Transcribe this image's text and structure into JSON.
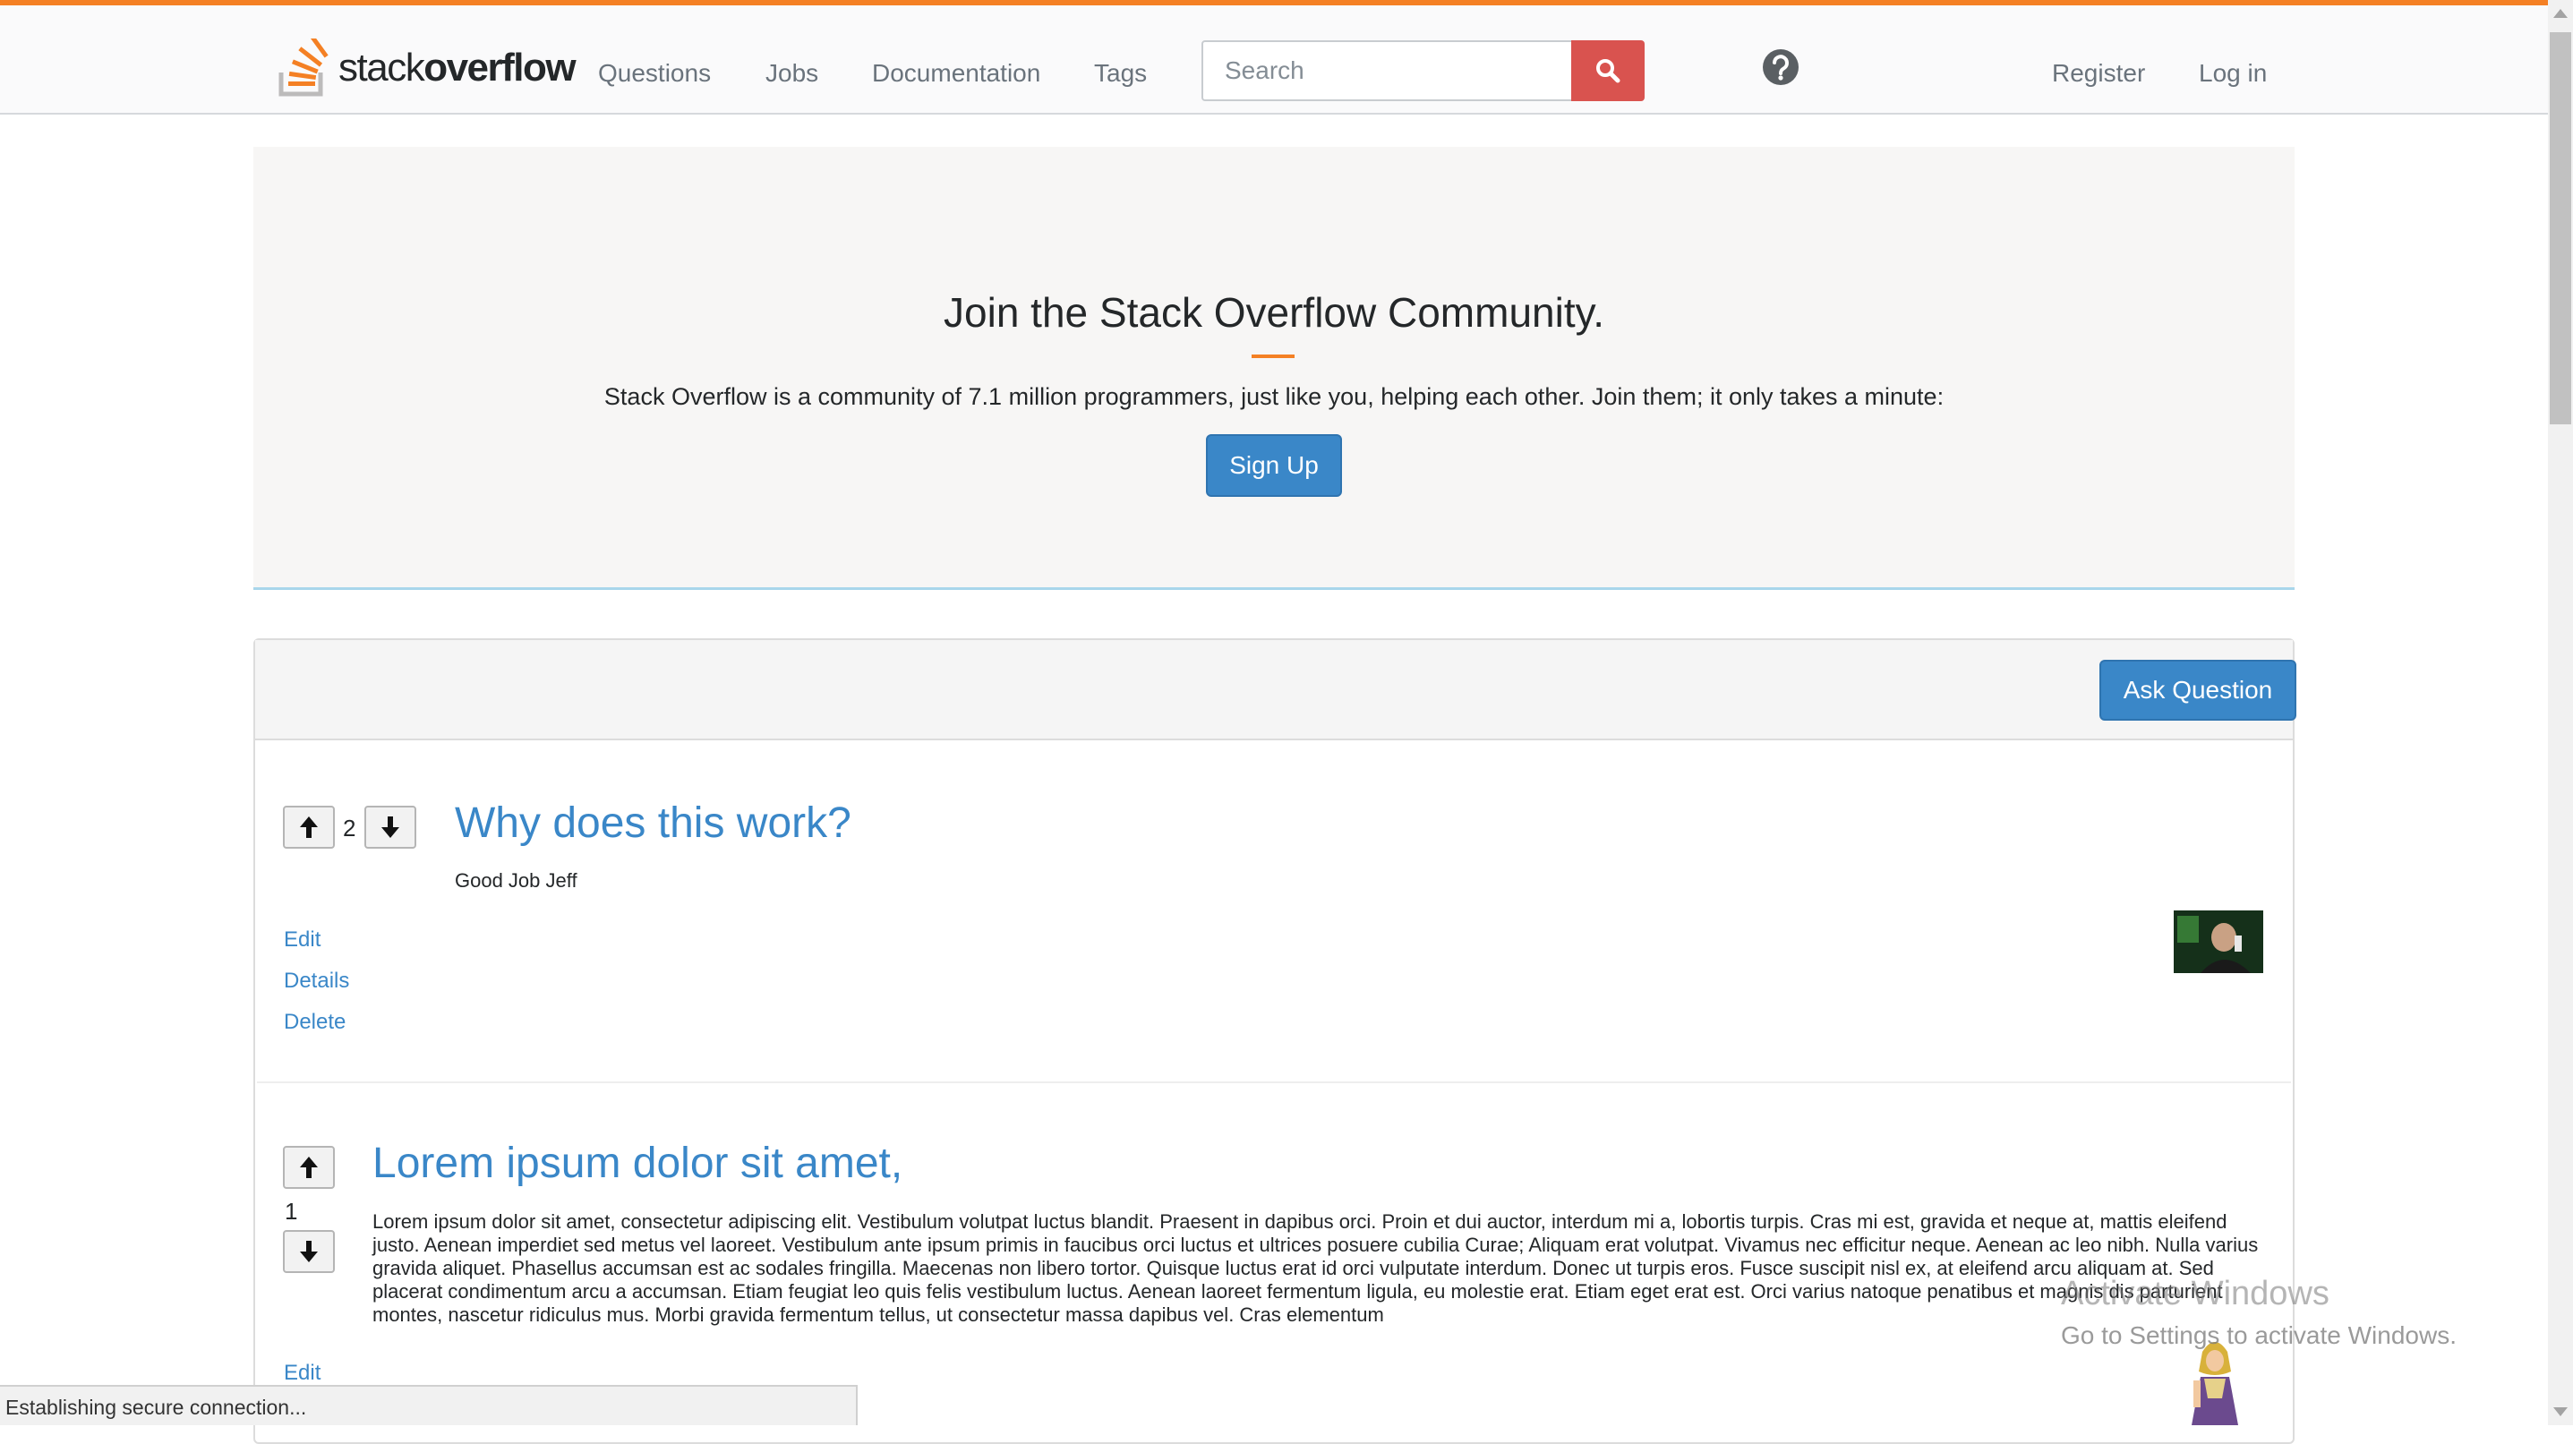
{
  "header": {
    "logo": {
      "word1": "stack",
      "word2": "overflow"
    },
    "nav": [
      "Questions",
      "Jobs",
      "Documentation",
      "Tags"
    ],
    "search_placeholder": "Search",
    "search_icon": "search-icon",
    "help_icon": "help-icon",
    "register": "Register",
    "login": "Log in"
  },
  "hero": {
    "title": "Join the Stack Overflow Community.",
    "text": "Stack Overflow is a community of 7.1 million programmers, just like you, helping each other. Join them; it only takes a minute:",
    "signup": "Sign Up"
  },
  "panel": {
    "ask_button": "Ask Question"
  },
  "questions": [
    {
      "votes": "2",
      "title": "Why does this work?",
      "body": "Good Job Jeff",
      "actions": [
        "Edit",
        "Details",
        "Delete"
      ]
    },
    {
      "votes": "1",
      "title": "Lorem ipsum dolor sit amet,",
      "body": "Lorem ipsum dolor sit amet, consectetur adipiscing elit. Vestibulum volutpat luctus blandit. Praesent in dapibus orci. Proin et dui auctor, interdum mi a, lobortis turpis. Cras mi est, gravida et neque at, mattis eleifend justo. Aenean imperdiet sed metus vel laoreet. Vestibulum ante ipsum primis in faucibus orci luctus et ultrices posuere cubilia Curae; Aliquam erat volutpat. Vivamus nec efficitur neque. Aenean ac leo nibh. Nulla varius gravida aliquet. Phasellus accumsan est ac sodales fringilla. Maecenas non libero tortor. Quisque luctus erat id orci vulputate interdum. Donec ut turpis eros. Fusce suscipit nisl ex, at eleifend arcu aliquam at. Sed placerat condimentum arcu a accumsan. Etiam feugiat leo quis felis vestibulum luctus. Aenean laoreet fermentum ligula, eu molestie erat. Etiam eget erat est. Orci varius natoque penatibus et magnis dis parturient montes, nascetur ridiculus mus. Morbi gravida fermentum tellus, ut consectetur massa dapibus vel. Cras elementum",
      "actions": [
        "Edit"
      ]
    }
  ],
  "overlay": {
    "watermark_title": "Activate Windows",
    "watermark_text": "Go to Settings to activate Windows."
  },
  "status": "Establishing secure connection...",
  "colors": {
    "accent": "#f48024",
    "link": "#3a87c8",
    "search_button": "#d9534f"
  }
}
